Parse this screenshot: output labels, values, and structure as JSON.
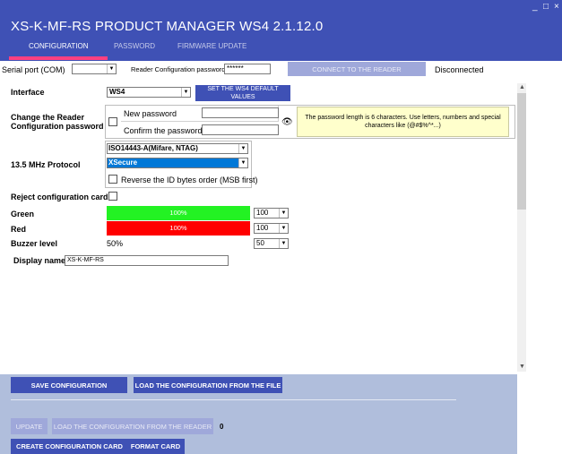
{
  "app": {
    "title": "XS-K-MF-RS  PRODUCT MANAGER WS4 2.1.12.0"
  },
  "window": {
    "minimize": "_",
    "maximize": "□",
    "close": "×"
  },
  "tabs": [
    "CONFIGURATION",
    "PASSWORD",
    "FIRMWARE UPDATE"
  ],
  "toolbar": {
    "serial_label": "Serial port (COM)",
    "serial_value": "",
    "password_label": "Reader Configuration password",
    "password_value": "******",
    "connect_label": "CONNECT TO THE READER",
    "status": "Disconnected"
  },
  "form": {
    "interface_label": "Interface",
    "interface_value": "WS4",
    "default_btn": "SET THE WS4 DEFAULT VALUES",
    "change_pw_label": "Change the Reader Configuration password",
    "new_pw_label": "New password",
    "confirm_pw_label": "Confirm the password",
    "pw_hint": "The password length is 6 characters. Use letters, numbers and special characters like (@#$%^*...)",
    "protocol_label": "13.5 MHz Protocol",
    "protocol_value": "ISO14443-A(Mifare, NTAG)",
    "protocol_sub_value": "XSecure",
    "reverse_label": "Reverse the ID bytes order (MSB first)",
    "reject_label": "Reject configuration card",
    "green_label": "Green",
    "green_percent": "100%",
    "green_level": 1.0,
    "green_value": "100",
    "red_label": "Red",
    "red_percent": "100%",
    "red_level": 1.0,
    "red_value": "100",
    "buzzer_label": "Buzzer level",
    "buzzer_percent": "50%",
    "buzzer_value": "50",
    "display_label": "Display name",
    "display_value": "XS-K-MF-RS"
  },
  "colors": {
    "primary": "#3f51b5",
    "accent": "#ff4081",
    "green": "#23f223",
    "red": "#ff0000",
    "panel": "#b0bedc",
    "hint_bg": "#ffffcc"
  },
  "bottom": {
    "save": "SAVE CONFIGURATION",
    "load_file": "LOAD THE CONFIGURATION FROM THE FILE",
    "update": "UPDATE",
    "load_reader": "LOAD THE CONFIGURATION FROM THE READER",
    "count": "0",
    "create_card": "CREATE CONFIGURATION CARD",
    "format_card": "FORMAT CARD"
  }
}
